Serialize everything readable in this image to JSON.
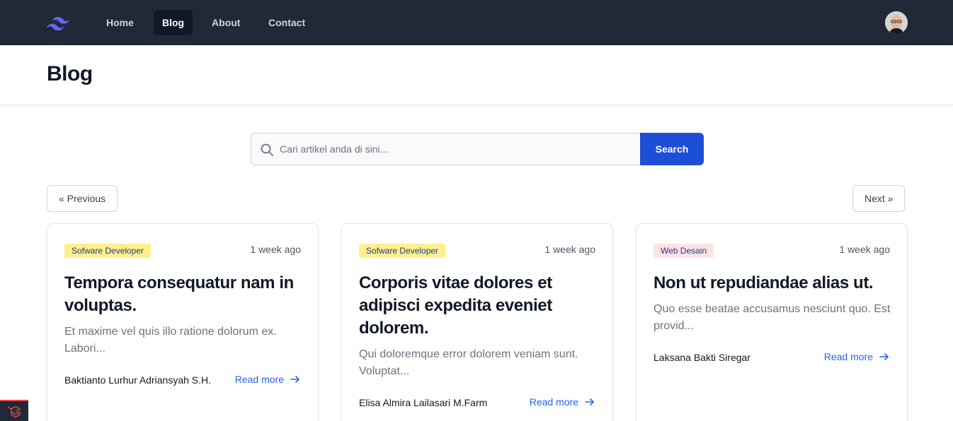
{
  "nav": {
    "logo": "tailwind-logo",
    "links": [
      "Home",
      "Blog",
      "About",
      "Contact"
    ],
    "active": "Blog",
    "avatar": "user-avatar"
  },
  "header": {
    "title": "Blog"
  },
  "search": {
    "placeholder": "Cari artikel anda di sini...",
    "button_label": "Search",
    "value": ""
  },
  "pagination": {
    "previous_label": "« Previous",
    "next_label": "Next »"
  },
  "posts": [
    {
      "category": "Sofware Developer",
      "category_bg": "#fef08a",
      "category_color": "#1e3a8a",
      "date": "1 week ago",
      "title": "Tempora consequatur nam in voluptas.",
      "excerpt": "Et maxime vel quis illo ratione dolorum ex. Labori...",
      "author": "Baktianto Lurhur Adriansyah S.H.",
      "read_more": "Read more"
    },
    {
      "category": "Sofware Developer",
      "category_bg": "#fef08a",
      "category_color": "#1e3a8a",
      "date": "1 week ago",
      "title": "Corporis vitae dolores et adipisci expedita eveniet dolorem.",
      "excerpt": "Qui doloremque error dolorem veniam sunt. Voluptat...",
      "author": "Elisa Almira Lailasari M.Farm",
      "read_more": "Read more"
    },
    {
      "category": "Web Desain",
      "category_bg": "#fee2e2",
      "category_color": "#1e3a8a",
      "date": "1 week ago",
      "title": "Non ut repudiandae alias ut.",
      "excerpt": "Quo esse beatae accusamus nesciunt quo. Est provid...",
      "author": "Laksana Bakti Siregar",
      "read_more": "Read more"
    }
  ],
  "colors": {
    "navbar": "#1f2937",
    "accent": "#1d4ed8",
    "link": "#2563eb"
  }
}
